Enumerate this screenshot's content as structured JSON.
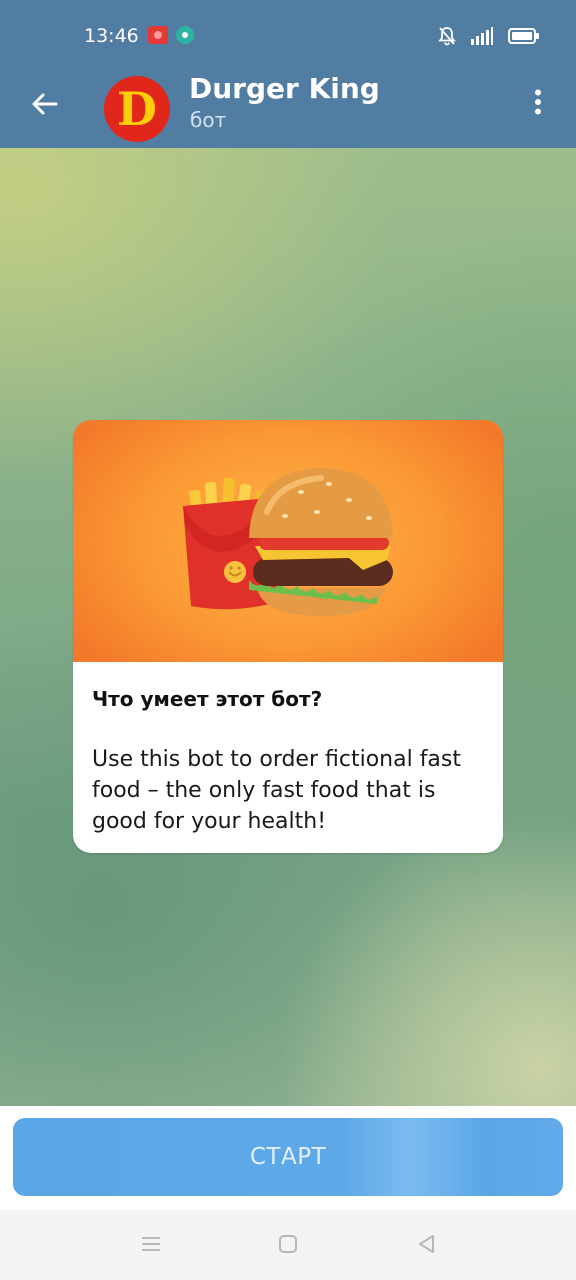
{
  "status_bar": {
    "time": "13:46",
    "icons": [
      "screen-record-icon",
      "cast-icon",
      "bell-muted-icon",
      "signal-icon",
      "battery-icon"
    ]
  },
  "header": {
    "title": "Durger King",
    "subtitle": "бот",
    "avatar_letter": "D",
    "back_icon": "arrow-left-icon",
    "menu_icon": "more-vertical-icon"
  },
  "bot_info": {
    "image": "fries-and-burger-illustration",
    "heading": "Что умеет этот бот?",
    "description": "Use this bot to order fictional fast food – the only fast food that is good for your health!"
  },
  "start_button": {
    "label": "СТАРТ"
  },
  "nav_bar": {
    "icons": [
      "menu-icon",
      "home-icon",
      "back-icon"
    ]
  },
  "colors": {
    "header_bg": "#517da2",
    "avatar_bg": "#e1261c",
    "avatar_letter": "#ffcd05",
    "start_button_bg": "#5ba6e6",
    "card_image_bg": "#fb9a34"
  }
}
